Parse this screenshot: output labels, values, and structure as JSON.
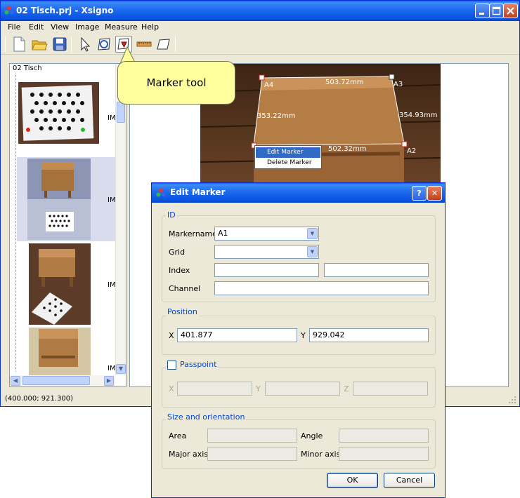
{
  "app": {
    "window_title": "02 Tisch.prj - Xsigno"
  },
  "menubar": {
    "items": [
      "File",
      "Edit",
      "View",
      "Image",
      "Measure",
      "Help"
    ]
  },
  "toolbar": {
    "tools": [
      "new-file-icon",
      "open-folder-icon",
      "save-icon",
      "select-arrow-icon",
      "zoom-tool-icon",
      "marker-tool-icon",
      "ruler-icon",
      "polygon-icon"
    ],
    "pressed": "marker-tool-icon"
  },
  "tooltip": {
    "text": "Marker tool"
  },
  "project": {
    "name": "02 Tisch"
  },
  "thumbnails": [
    {
      "label": "IMG_"
    },
    {
      "label": "IMG_"
    },
    {
      "label": "IMG_"
    },
    {
      "label": "IMG_"
    }
  ],
  "image_view": {
    "markers": [
      "A4",
      "A3",
      "A1",
      "A2"
    ],
    "measurements": [
      "503.72mm",
      "353.22mm",
      "354.93mm",
      "502.32mm"
    ]
  },
  "context_menu": {
    "items": [
      "Edit Marker",
      "Delete Marker"
    ],
    "selected": "Edit Marker"
  },
  "status_bar": {
    "text": "(400.000; 921.300)"
  },
  "dialog": {
    "title": "Edit Marker",
    "help_label": "?",
    "close_label": "✕",
    "id_group": {
      "title": "ID",
      "markername_label": "Markername",
      "markername_value": "A1",
      "grid_label": "Grid",
      "grid_value": "",
      "index_label": "Index",
      "index_value_1": "",
      "index_value_2": "",
      "channel_label": "Channel",
      "channel_value": ""
    },
    "position_group": {
      "title": "Position",
      "x_label": "X",
      "x_value": "401.877",
      "y_label": "Y",
      "y_value": "929.042"
    },
    "passpoint_group": {
      "title": "Passpoint",
      "checked": false,
      "x_label": "X",
      "y_label": "Y",
      "z_label": "Z"
    },
    "size_group": {
      "title": "Size and orientation",
      "area_label": "Area",
      "angle_label": "Angle",
      "major_label": "Major axis",
      "minor_label": "Minor axis"
    },
    "ok_label": "OK",
    "cancel_label": "Cancel"
  },
  "colors": {
    "title_bar": "#0a5ee8",
    "window_bg": "#ece9d8",
    "tooltip_bg": "#ffff9e",
    "selection": "#316ac5",
    "group_title": "#0046d5"
  }
}
